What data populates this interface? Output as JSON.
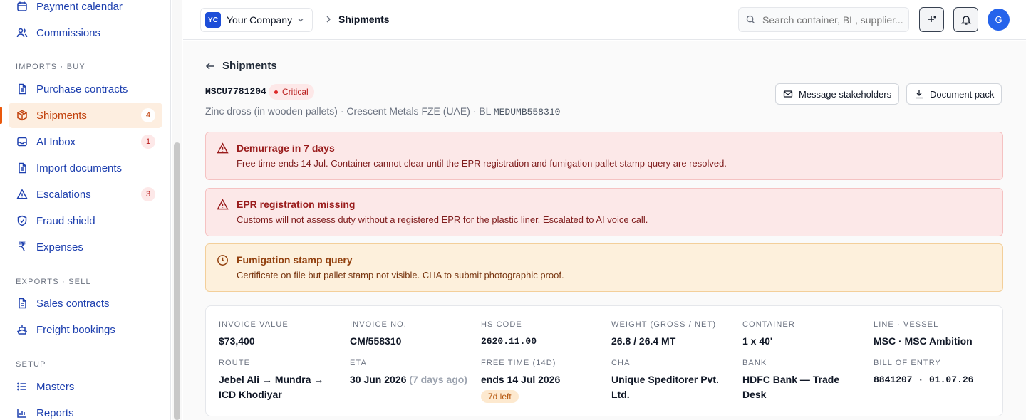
{
  "sidebar": {
    "items": [
      {
        "label": "Payment calendar"
      },
      {
        "label": "Commissions"
      },
      {
        "label": "Purchase contracts"
      },
      {
        "label": "Shipments",
        "badge": "4"
      },
      {
        "label": "AI Inbox",
        "badge": "1"
      },
      {
        "label": "Import documents"
      },
      {
        "label": "Escalations",
        "badge": "3"
      },
      {
        "label": "Fraud shield"
      },
      {
        "label": "Expenses"
      },
      {
        "label": "Sales contracts"
      },
      {
        "label": "Freight bookings"
      },
      {
        "label": "Masters"
      },
      {
        "label": "Reports"
      }
    ],
    "sections": {
      "imports": "IMPORTS · BUY",
      "exports": "EXPORTS · SELL",
      "setup": "SETUP"
    }
  },
  "topbar": {
    "company_initials": "YC",
    "company_name": "Your Company",
    "breadcrumb": "Shipments",
    "search_placeholder": "Search container, BL, supplier...",
    "avatar_initial": "G"
  },
  "shipment": {
    "back_title": "Shipments",
    "container_id": "MSCU7781204",
    "status": "Critical",
    "description": "Zinc dross (in wooden pallets) · Crescent Metals FZE (UAE) · BL",
    "bl_number": "MEDUMB558310",
    "message_button": "Message stakeholders",
    "document_button": "Document pack"
  },
  "alerts": [
    {
      "title": "Demurrage in 7 days",
      "body": "Free time ends 14 Jul. Container cannot clear until the EPR registration and fumigation pallet stamp query are resolved."
    },
    {
      "title": "EPR registration missing",
      "body": "Customs will not assess duty without a registered EPR for the plastic liner. Escalated to AI voice call."
    },
    {
      "title": "Fumigation stamp query",
      "body": "Certificate on file but pallet stamp not visible. CHA to submit photographic proof."
    }
  ],
  "details": {
    "invoice_value": {
      "label": "INVOICE VALUE",
      "value": "$73,400"
    },
    "invoice_no": {
      "label": "INVOICE NO.",
      "value": "CM/558310"
    },
    "hs_code": {
      "label": "HS CODE",
      "value": "2620.11.00"
    },
    "weight": {
      "label": "WEIGHT (GROSS / NET)",
      "value": "26.8 / 26.4 MT"
    },
    "container": {
      "label": "CONTAINER",
      "value": "1 x 40'"
    },
    "line_vessel": {
      "label": "LINE · VESSEL",
      "value": "MSC · MSC Ambition"
    },
    "route": {
      "label": "ROUTE",
      "value": "Jebel Ali → Mundra → ICD Khodiyar"
    },
    "eta": {
      "label": "ETA",
      "value": "30 Jun 2026",
      "note": "(7 days ago)"
    },
    "free_time": {
      "label": "FREE TIME (14D)",
      "value": "ends 14 Jul 2026",
      "pill": "7d left"
    },
    "cha": {
      "label": "CHA",
      "value": "Unique Speditorer Pvt. Ltd."
    },
    "bank": {
      "label": "BANK",
      "value": "HDFC Bank — Trade Desk"
    },
    "bill_of_entry": {
      "label": "BILL OF ENTRY",
      "value": "8841207 · 01.07.26"
    }
  }
}
